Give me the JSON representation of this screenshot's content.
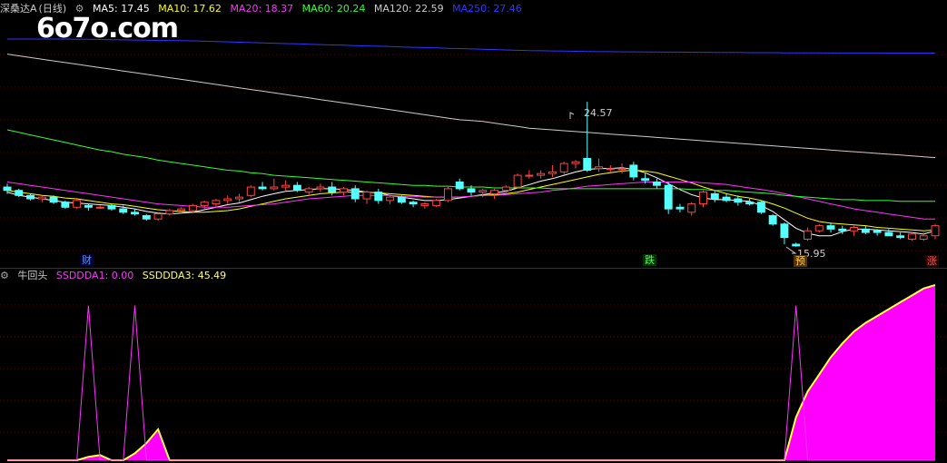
{
  "header": {
    "name": "深桑达A",
    "period": "(日线)",
    "ma": [
      {
        "label": "MA5: 17.45",
        "color": "#ffffff"
      },
      {
        "label": "MA10: 17.62",
        "color": "#ffff00"
      },
      {
        "label": "MA20: 18.37",
        "color": "#ff33ff"
      },
      {
        "label": "MA60: 20.24",
        "color": "#33ff33"
      },
      {
        "label": "MA120: 22.59",
        "color": "#cccccc"
      },
      {
        "label": "MA250: 27.46",
        "color": "#3333ff"
      }
    ]
  },
  "watermark": "6o7o.com",
  "price_labels": {
    "high": "24.57",
    "low": "15.95"
  },
  "markers": [
    {
      "text": "财",
      "color": "#5599ff",
      "bg": "#000033"
    },
    {
      "text": "跌",
      "color": "#55ff55",
      "bg": "#003300"
    },
    {
      "text": "预",
      "color": "#ffcc55",
      "bg": "#553300"
    },
    {
      "text": "涨",
      "color": "#ff5555",
      "bg": "#330000"
    }
  ],
  "sub_header": {
    "title": "牛回头",
    "lines": [
      {
        "label": "SSDDDA1: 0.00",
        "color": "#ff33ff"
      },
      {
        "label": "SSDDDA3: 45.49",
        "color": "#ffff66"
      }
    ]
  },
  "colors": {
    "up": "#ff4444",
    "down": "#55ffff",
    "grid": "#550000"
  },
  "chart_data": {
    "type": "line",
    "candles": [
      [
        19.5,
        19.7,
        19.1,
        19.3
      ],
      [
        19.3,
        19.4,
        18.9,
        19.0
      ],
      [
        19.0,
        19.1,
        18.7,
        18.8
      ],
      [
        18.8,
        19.0,
        18.6,
        18.9
      ],
      [
        18.9,
        19.0,
        18.5,
        18.6
      ],
      [
        18.6,
        18.7,
        18.2,
        18.3
      ],
      [
        18.3,
        18.8,
        18.2,
        18.7
      ],
      [
        18.4,
        18.5,
        18.1,
        18.3
      ],
      [
        18.3,
        18.4,
        18.2,
        18.3
      ],
      [
        18.4,
        18.5,
        18.1,
        18.2
      ],
      [
        18.2,
        18.4,
        17.9,
        18.0
      ],
      [
        18.0,
        18.2,
        17.8,
        17.9
      ],
      [
        17.8,
        17.9,
        17.5,
        17.6
      ],
      [
        17.6,
        18.0,
        17.5,
        17.9
      ],
      [
        17.9,
        18.2,
        17.8,
        18.1
      ],
      [
        18.1,
        18.3,
        17.9,
        18.2
      ],
      [
        18.1,
        18.5,
        18.0,
        18.4
      ],
      [
        18.4,
        18.7,
        18.2,
        18.6
      ],
      [
        18.5,
        18.8,
        18.3,
        18.7
      ],
      [
        18.7,
        19.0,
        18.5,
        18.8
      ],
      [
        18.8,
        19.1,
        18.6,
        18.9
      ],
      [
        19.0,
        19.6,
        18.9,
        19.5
      ],
      [
        19.5,
        19.8,
        19.3,
        19.4
      ],
      [
        19.4,
        20.0,
        19.3,
        19.5
      ],
      [
        19.5,
        19.9,
        19.3,
        19.6
      ],
      [
        19.6,
        19.8,
        19.2,
        19.3
      ],
      [
        19.2,
        19.5,
        19.0,
        19.4
      ],
      [
        19.4,
        19.7,
        19.2,
        19.5
      ],
      [
        19.5,
        19.8,
        19.0,
        19.2
      ],
      [
        19.2,
        19.5,
        19.0,
        19.4
      ],
      [
        19.4,
        19.6,
        18.6,
        18.8
      ],
      [
        18.8,
        19.3,
        18.5,
        19.2
      ],
      [
        19.2,
        19.4,
        18.5,
        18.7
      ],
      [
        18.7,
        19.0,
        18.5,
        18.9
      ],
      [
        18.9,
        19.0,
        18.5,
        18.6
      ],
      [
        18.6,
        18.7,
        18.3,
        18.5
      ],
      [
        18.4,
        18.6,
        18.2,
        18.5
      ],
      [
        18.4,
        18.8,
        18.3,
        18.7
      ],
      [
        18.7,
        19.5,
        18.6,
        19.4
      ],
      [
        19.8,
        20.0,
        19.3,
        19.4
      ],
      [
        19.4,
        19.6,
        19.0,
        19.2
      ],
      [
        19.2,
        19.4,
        18.9,
        19.3
      ],
      [
        19.1,
        19.4,
        18.8,
        19.3
      ],
      [
        19.3,
        19.6,
        19.1,
        19.5
      ],
      [
        19.5,
        20.3,
        19.4,
        20.2
      ],
      [
        20.2,
        20.5,
        20.0,
        20.2
      ],
      [
        20.2,
        20.5,
        20.0,
        20.3
      ],
      [
        20.3,
        20.8,
        20.1,
        20.4
      ],
      [
        20.4,
        21.0,
        20.2,
        20.9
      ],
      [
        20.9,
        21.1,
        20.6,
        21.0
      ],
      [
        21.2,
        24.57,
        20.4,
        20.5
      ],
      [
        20.6,
        21.2,
        20.4,
        20.7
      ],
      [
        20.6,
        20.8,
        20.4,
        20.6
      ],
      [
        20.6,
        20.9,
        20.3,
        20.6
      ],
      [
        20.8,
        21.0,
        19.9,
        20.1
      ],
      [
        20.0,
        20.3,
        19.7,
        19.9
      ],
      [
        19.8,
        20.0,
        19.4,
        19.6
      ],
      [
        19.6,
        19.8,
        17.9,
        18.2
      ],
      [
        18.3,
        18.5,
        18.0,
        18.2
      ],
      [
        18.0,
        18.6,
        17.8,
        18.5
      ],
      [
        18.5,
        19.3,
        18.3,
        19.2
      ],
      [
        19.1,
        19.3,
        18.6,
        18.8
      ],
      [
        18.9,
        19.1,
        18.6,
        18.7
      ],
      [
        18.8,
        19.0,
        18.4,
        18.6
      ],
      [
        18.6,
        18.8,
        18.4,
        18.5
      ],
      [
        18.6,
        18.7,
        17.9,
        18.0
      ],
      [
        17.8,
        17.9,
        17.2,
        17.3
      ],
      [
        17.3,
        17.4,
        16.1,
        16.5
      ],
      [
        16.1,
        16.2,
        15.95,
        16.0
      ],
      [
        16.4,
        17.1,
        16.3,
        16.9
      ],
      [
        16.9,
        17.3,
        16.8,
        17.2
      ],
      [
        17.2,
        17.4,
        16.8,
        17.0
      ],
      [
        17.0,
        17.2,
        16.7,
        16.9
      ],
      [
        16.9,
        17.2,
        16.6,
        17.1
      ],
      [
        17.0,
        17.2,
        16.7,
        16.8
      ],
      [
        16.9,
        17.0,
        16.6,
        16.8
      ],
      [
        16.8,
        17.0,
        16.6,
        16.6
      ],
      [
        16.6,
        16.8,
        16.4,
        16.5
      ],
      [
        16.4,
        16.8,
        16.3,
        16.7
      ],
      [
        16.4,
        16.8,
        16.3,
        16.6
      ],
      [
        16.6,
        17.3,
        16.4,
        17.2
      ]
    ],
    "ma_series": [
      {
        "name": "MA5",
        "color": "#ffffff",
        "values": [
          19.2,
          19.0,
          18.9,
          18.8,
          18.7,
          18.6,
          18.55,
          18.5,
          18.45,
          18.4,
          18.3,
          18.2,
          18.05,
          17.95,
          17.9,
          17.95,
          18.0,
          18.15,
          18.3,
          18.45,
          18.55,
          18.75,
          18.95,
          19.1,
          19.25,
          19.3,
          19.35,
          19.4,
          19.4,
          19.35,
          19.3,
          19.2,
          19.15,
          19.0,
          18.9,
          18.8,
          18.7,
          18.7,
          18.75,
          18.85,
          18.95,
          19.05,
          19.15,
          19.25,
          19.45,
          19.65,
          19.85,
          20.0,
          20.2,
          20.4,
          20.55,
          20.6,
          20.6,
          20.65,
          20.55,
          20.35,
          20.05,
          19.7,
          19.35,
          19.05,
          18.85,
          18.75,
          18.75,
          18.7,
          18.65,
          18.4,
          18.05,
          17.55,
          17.05,
          16.75,
          16.6,
          16.6,
          16.85,
          17.0,
          17.0,
          16.95,
          16.9,
          16.85,
          16.8,
          16.7,
          16.9
        ]
      },
      {
        "name": "MA10",
        "color": "#ffff00",
        "values": [
          19.3,
          19.2,
          19.1,
          19.0,
          18.95,
          18.85,
          18.8,
          18.7,
          18.6,
          18.5,
          18.45,
          18.35,
          18.25,
          18.15,
          18.1,
          18.05,
          18.0,
          18.0,
          18.05,
          18.1,
          18.2,
          18.35,
          18.5,
          18.65,
          18.8,
          18.9,
          19.0,
          19.1,
          19.15,
          19.2,
          19.2,
          19.2,
          19.15,
          19.1,
          19.05,
          19.0,
          18.95,
          18.9,
          18.9,
          18.9,
          18.95,
          19.0,
          19.05,
          19.1,
          19.2,
          19.35,
          19.5,
          19.65,
          19.8,
          19.95,
          20.1,
          20.25,
          20.35,
          20.45,
          20.5,
          20.45,
          20.35,
          20.15,
          19.95,
          19.75,
          19.5,
          19.3,
          19.1,
          18.95,
          18.85,
          18.7,
          18.5,
          18.25,
          17.95,
          17.65,
          17.45,
          17.35,
          17.3,
          17.25,
          17.2,
          17.1,
          17.05,
          17.0,
          16.95,
          16.9,
          16.95
        ]
      },
      {
        "name": "MA20",
        "color": "#ff33ff",
        "values": [
          19.8,
          19.7,
          19.6,
          19.5,
          19.4,
          19.3,
          19.2,
          19.1,
          19.0,
          18.9,
          18.8,
          18.7,
          18.6,
          18.5,
          18.45,
          18.4,
          18.35,
          18.3,
          18.3,
          18.3,
          18.35,
          18.4,
          18.45,
          18.5,
          18.6,
          18.7,
          18.8,
          18.85,
          18.9,
          18.95,
          19.0,
          19.0,
          19.0,
          19.0,
          18.95,
          18.95,
          18.9,
          18.9,
          18.9,
          18.9,
          18.95,
          19.0,
          19.0,
          19.05,
          19.1,
          19.15,
          19.2,
          19.3,
          19.35,
          19.45,
          19.55,
          19.6,
          19.65,
          19.7,
          19.75,
          19.8,
          19.8,
          19.8,
          19.8,
          19.8,
          19.75,
          19.7,
          19.65,
          19.55,
          19.45,
          19.35,
          19.25,
          19.1,
          18.95,
          18.8,
          18.65,
          18.5,
          18.35,
          18.2,
          18.1,
          18.0,
          17.9,
          17.8,
          17.7,
          17.6,
          17.6
        ]
      },
      {
        "name": "MA60",
        "color": "#33ff33",
        "values": [
          22.9,
          22.75,
          22.6,
          22.45,
          22.3,
          22.15,
          22.0,
          21.85,
          21.7,
          21.6,
          21.45,
          21.35,
          21.25,
          21.1,
          21.0,
          20.9,
          20.8,
          20.7,
          20.6,
          20.5,
          20.45,
          20.35,
          20.3,
          20.2,
          20.15,
          20.1,
          20.05,
          20.0,
          19.95,
          19.9,
          19.85,
          19.8,
          19.75,
          19.7,
          19.65,
          19.6,
          19.6,
          19.55,
          19.55,
          19.5,
          19.5,
          19.5,
          19.45,
          19.45,
          19.45,
          19.45,
          19.45,
          19.4,
          19.4,
          19.4,
          19.4,
          19.4,
          19.4,
          19.4,
          19.4,
          19.4,
          19.4,
          19.4,
          19.4,
          19.35,
          19.35,
          19.3,
          19.3,
          19.25,
          19.2,
          19.15,
          19.1,
          19.0,
          18.95,
          18.9,
          18.85,
          18.8,
          18.75,
          18.75,
          18.7,
          18.7,
          18.7,
          18.65,
          18.65,
          18.65,
          18.65
        ]
      },
      {
        "name": "MA120",
        "color": "#cccccc",
        "values": [
          27.4,
          27.3,
          27.2,
          27.1,
          27.0,
          26.9,
          26.8,
          26.7,
          26.6,
          26.5,
          26.4,
          26.3,
          26.2,
          26.1,
          26.0,
          25.9,
          25.8,
          25.7,
          25.6,
          25.5,
          25.4,
          25.3,
          25.2,
          25.1,
          25.0,
          24.9,
          24.8,
          24.7,
          24.6,
          24.5,
          24.4,
          24.3,
          24.2,
          24.1,
          24.0,
          23.9,
          23.8,
          23.7,
          23.6,
          23.5,
          23.45,
          23.4,
          23.3,
          23.2,
          23.1,
          23.0,
          22.95,
          22.9,
          22.85,
          22.8,
          22.75,
          22.7,
          22.65,
          22.6,
          22.55,
          22.5,
          22.45,
          22.4,
          22.35,
          22.3,
          22.25,
          22.2,
          22.15,
          22.1,
          22.05,
          22.0,
          21.95,
          21.9,
          21.85,
          21.8,
          21.75,
          21.7,
          21.65,
          21.6,
          21.55,
          21.5,
          21.45,
          21.4,
          21.35,
          21.3,
          21.25
        ]
      },
      {
        "name": "MA250",
        "color": "#3333ff",
        "values": [
          28.3,
          28.3,
          28.3,
          28.3,
          28.3,
          28.3,
          28.29,
          28.28,
          28.27,
          28.26,
          28.25,
          28.24,
          28.23,
          28.22,
          28.21,
          28.2,
          28.19,
          28.17,
          28.15,
          28.13,
          28.11,
          28.09,
          28.07,
          28.05,
          28.03,
          28.01,
          27.99,
          27.97,
          27.95,
          27.93,
          27.91,
          27.89,
          27.87,
          27.85,
          27.83,
          27.81,
          27.79,
          27.77,
          27.75,
          27.73,
          27.71,
          27.69,
          27.67,
          27.65,
          27.63,
          27.61,
          27.6,
          27.59,
          27.58,
          27.57,
          27.56,
          27.55,
          27.55,
          27.54,
          27.54,
          27.53,
          27.53,
          27.52,
          27.52,
          27.51,
          27.51,
          27.5,
          27.5,
          27.5,
          27.49,
          27.49,
          27.49,
          27.48,
          27.48,
          27.48,
          27.48,
          27.47,
          27.47,
          27.47,
          27.47,
          27.47,
          27.46,
          27.46,
          27.46,
          27.46,
          27.46
        ]
      }
    ],
    "sub_series": {
      "SSDDDA1": [
        0,
        0,
        0,
        0,
        0,
        0,
        0,
        90,
        0,
        0,
        0,
        90,
        0,
        0,
        0,
        0,
        0,
        0,
        0,
        0,
        0,
        0,
        0,
        0,
        0,
        0,
        0,
        0,
        0,
        0,
        0,
        0,
        0,
        0,
        0,
        0,
        0,
        0,
        0,
        0,
        0,
        0,
        0,
        0,
        0,
        0,
        0,
        0,
        0,
        0,
        0,
        0,
        0,
        0,
        0,
        0,
        0,
        0,
        0,
        0,
        0,
        0,
        0,
        0,
        0,
        0,
        0,
        0,
        90,
        0,
        0,
        0,
        0,
        0,
        0,
        0,
        0,
        0,
        0,
        0,
        0
      ],
      "SSDDDA3": [
        0,
        0,
        0,
        0,
        0,
        0,
        0,
        2,
        3,
        0,
        0,
        4,
        10,
        18,
        0,
        0,
        0,
        0,
        0,
        0,
        0,
        0,
        0,
        0,
        0,
        0,
        0,
        0,
        0,
        0,
        0,
        0,
        0,
        0,
        0,
        0,
        0,
        0,
        0,
        0,
        0,
        0,
        0,
        0,
        0,
        0,
        0,
        0,
        0,
        0,
        0,
        0,
        0,
        0,
        0,
        0,
        0,
        0,
        0,
        0,
        0,
        0,
        0,
        0,
        0,
        0,
        0,
        0,
        25,
        40,
        50,
        60,
        68,
        75,
        80,
        84,
        88,
        92,
        96,
        100,
        102
      ]
    }
  }
}
